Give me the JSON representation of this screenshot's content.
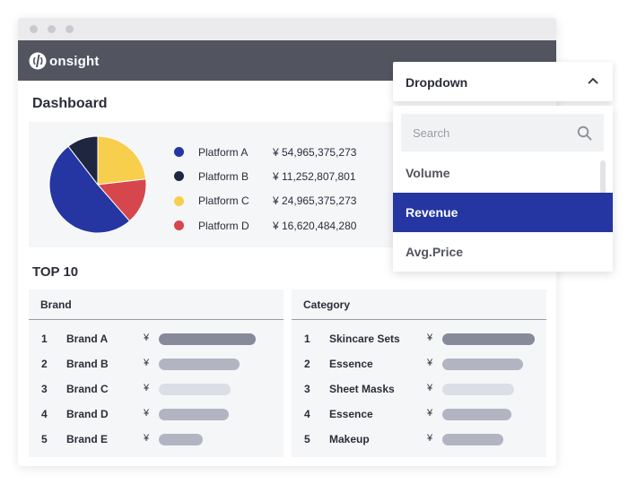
{
  "app": {
    "brand": "onsight"
  },
  "dashboard": {
    "title": "Dashboard",
    "colors": {
      "header": "#52545f",
      "accent": "#2536a3"
    }
  },
  "chart_data": {
    "type": "pie",
    "slices": [
      {
        "name": "Platform A",
        "value": 54965375273,
        "display": "¥ 54,965,375,273",
        "color": "#2536a3"
      },
      {
        "name": "Platform B",
        "value": 11252807801,
        "display": "¥ 11,252,807,801",
        "color": "#1f2740"
      },
      {
        "name": "Platform C",
        "value": 24965375273,
        "display": "¥ 24,965,375,273",
        "color": "#f8ce4d"
      },
      {
        "name": "Platform D",
        "value": 16620484280,
        "display": "¥ 16,620,484,280",
        "color": "#d6474d"
      }
    ],
    "draw_order": [
      "Platform C",
      "Platform D",
      "Platform A",
      "Platform B"
    ],
    "legend_placement": "right"
  },
  "top10": {
    "title": "TOP 10",
    "brand": {
      "header": "Brand",
      "rows": [
        {
          "rank": "1",
          "name": "Brand A",
          "currency": "¥",
          "level": 1.0,
          "color": "#878a9b"
        },
        {
          "rank": "2",
          "name": "Brand B",
          "currency": "¥",
          "level": 0.83,
          "color": "#b2b5c1"
        },
        {
          "rank": "3",
          "name": "Brand C",
          "currency": "¥",
          "level": 0.74,
          "color": "#dcdee5"
        },
        {
          "rank": "4",
          "name": "Brand D",
          "currency": "¥",
          "level": 0.72,
          "color": "#b2b5c1"
        },
        {
          "rank": "5",
          "name": "Brand E",
          "currency": "¥",
          "level": 0.45,
          "color": "#b2b5c1"
        }
      ]
    },
    "category": {
      "header": "Category",
      "rows": [
        {
          "rank": "1",
          "name": "Skincare Sets",
          "currency": "¥",
          "level": 1.0,
          "color": "#878a9b"
        },
        {
          "rank": "2",
          "name": "Essence",
          "currency": "¥",
          "level": 0.87,
          "color": "#b2b5c1"
        },
        {
          "rank": "3",
          "name": "Sheet Masks",
          "currency": "¥",
          "level": 0.78,
          "color": "#dcdee5"
        },
        {
          "rank": "4",
          "name": "Essence",
          "currency": "¥",
          "level": 0.75,
          "color": "#b2b5c1"
        },
        {
          "rank": "5",
          "name": "Makeup",
          "currency": "¥",
          "level": 0.66,
          "color": "#b2b5c1"
        }
      ]
    }
  },
  "dropdown": {
    "label": "Dropdown",
    "expanded": true,
    "search_placeholder": "Search",
    "options": [
      "Volume",
      "Revenue",
      "Avg.Price"
    ],
    "selected": "Revenue"
  }
}
